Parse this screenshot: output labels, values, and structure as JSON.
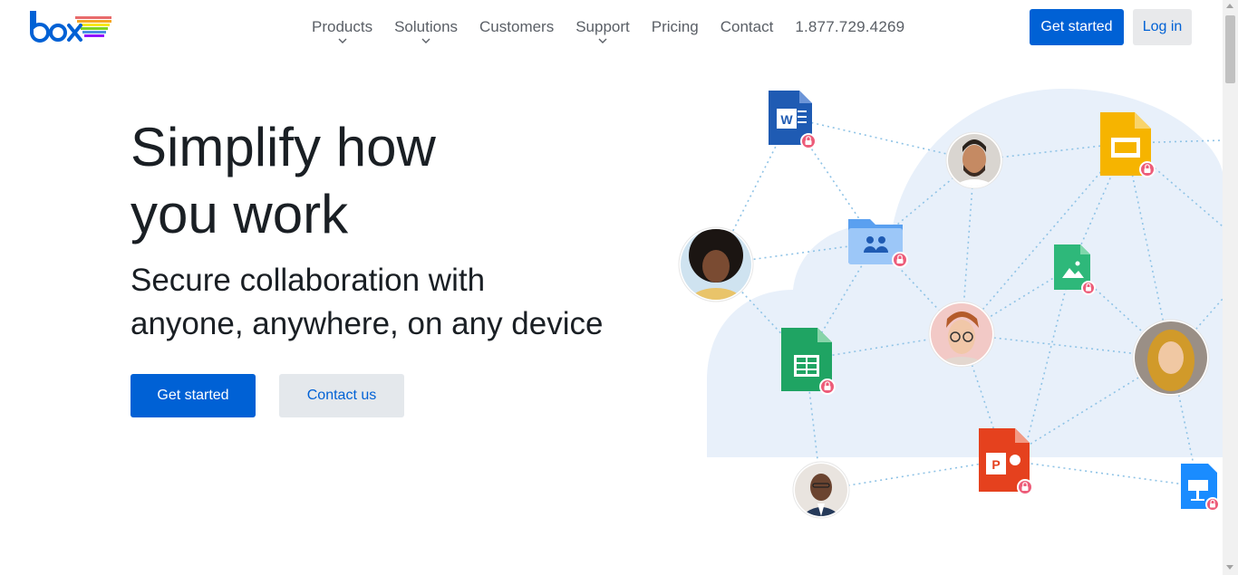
{
  "header": {
    "logo_text": "box",
    "nav": [
      {
        "label": "Products",
        "has_dropdown": true
      },
      {
        "label": "Solutions",
        "has_dropdown": true
      },
      {
        "label": "Customers",
        "has_dropdown": false
      },
      {
        "label": "Support",
        "has_dropdown": true
      },
      {
        "label": "Pricing",
        "has_dropdown": false
      },
      {
        "label": "Contact",
        "has_dropdown": false
      }
    ],
    "phone": "1.877.729.4269",
    "get_started_label": "Get started",
    "login_label": "Log in"
  },
  "hero": {
    "title_line1": "Simplify how",
    "title_line2": "you work",
    "subtitle_line1": "Secure collaboration with",
    "subtitle_line2": "anyone, anywhere, on any device",
    "primary_cta": "Get started",
    "secondary_cta": "Contact us"
  },
  "illustration": {
    "icons": [
      "word-doc-icon",
      "google-slides-icon",
      "shared-folder-icon",
      "image-file-icon",
      "google-sheets-icon",
      "powerpoint-icon",
      "keynote-icon",
      "lock-badge-icon"
    ],
    "avatars": [
      "avatar-man-beard",
      "avatar-woman-curly",
      "avatar-man-glasses",
      "avatar-woman-hijab",
      "avatar-man-suit"
    ]
  },
  "colors": {
    "brand_blue": "#0061d5",
    "secondary_bg": "#e4e8ec",
    "cloud": "#e8f0fa",
    "lock_badge": "#ed5c79",
    "connector": "#8fc3e6"
  }
}
